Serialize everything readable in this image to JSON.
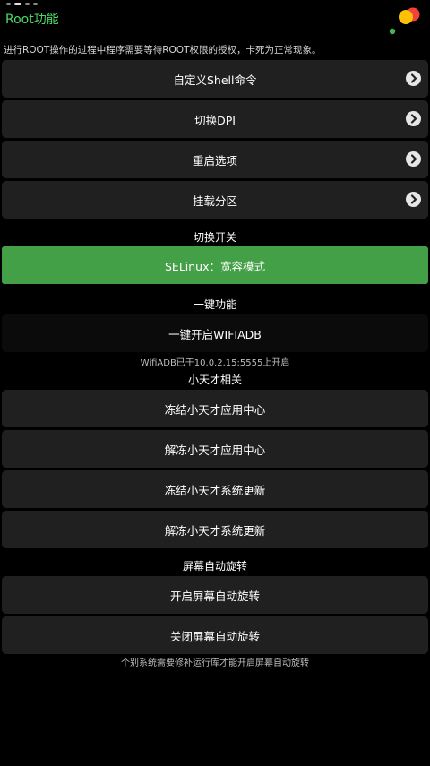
{
  "header": {
    "title": "Root功能",
    "page_count": 4,
    "active_page": 1
  },
  "notice": "进行ROOT操作的过程中程序需要等待ROOT权限的授权，卡死为正常现象。",
  "root_items": [
    {
      "label": "自定义Shell命令"
    },
    {
      "label": "切换DPI"
    },
    {
      "label": "重启选项"
    },
    {
      "label": "挂载分区"
    }
  ],
  "switch_section": {
    "title": "切换开关",
    "selinux_label": "SELinux：宽容模式"
  },
  "oneclick_section": {
    "title": "一键功能",
    "wifiadb_label": "一键开启WIFIADB",
    "wifiadb_status": "WifiADB已于10.0.2.15:5555上开启"
  },
  "xtc_section": {
    "title": "小天才相关",
    "items": [
      {
        "label": "冻结小天才应用中心"
      },
      {
        "label": "解冻小天才应用中心"
      },
      {
        "label": "冻结小天才系统更新"
      },
      {
        "label": "解冻小天才系统更新"
      }
    ]
  },
  "rotate_section": {
    "title": "屏幕自动旋转",
    "items": [
      {
        "label": "开启屏幕自动旋转"
      },
      {
        "label": "关闭屏幕自动旋转"
      }
    ],
    "note": "个别系统需要修补运行库才能开启屏幕自动旋转"
  },
  "colors": {
    "accent": "#4cd964",
    "toggle_on": "#43a047",
    "row_bg": "#202020",
    "background": "#000000"
  }
}
